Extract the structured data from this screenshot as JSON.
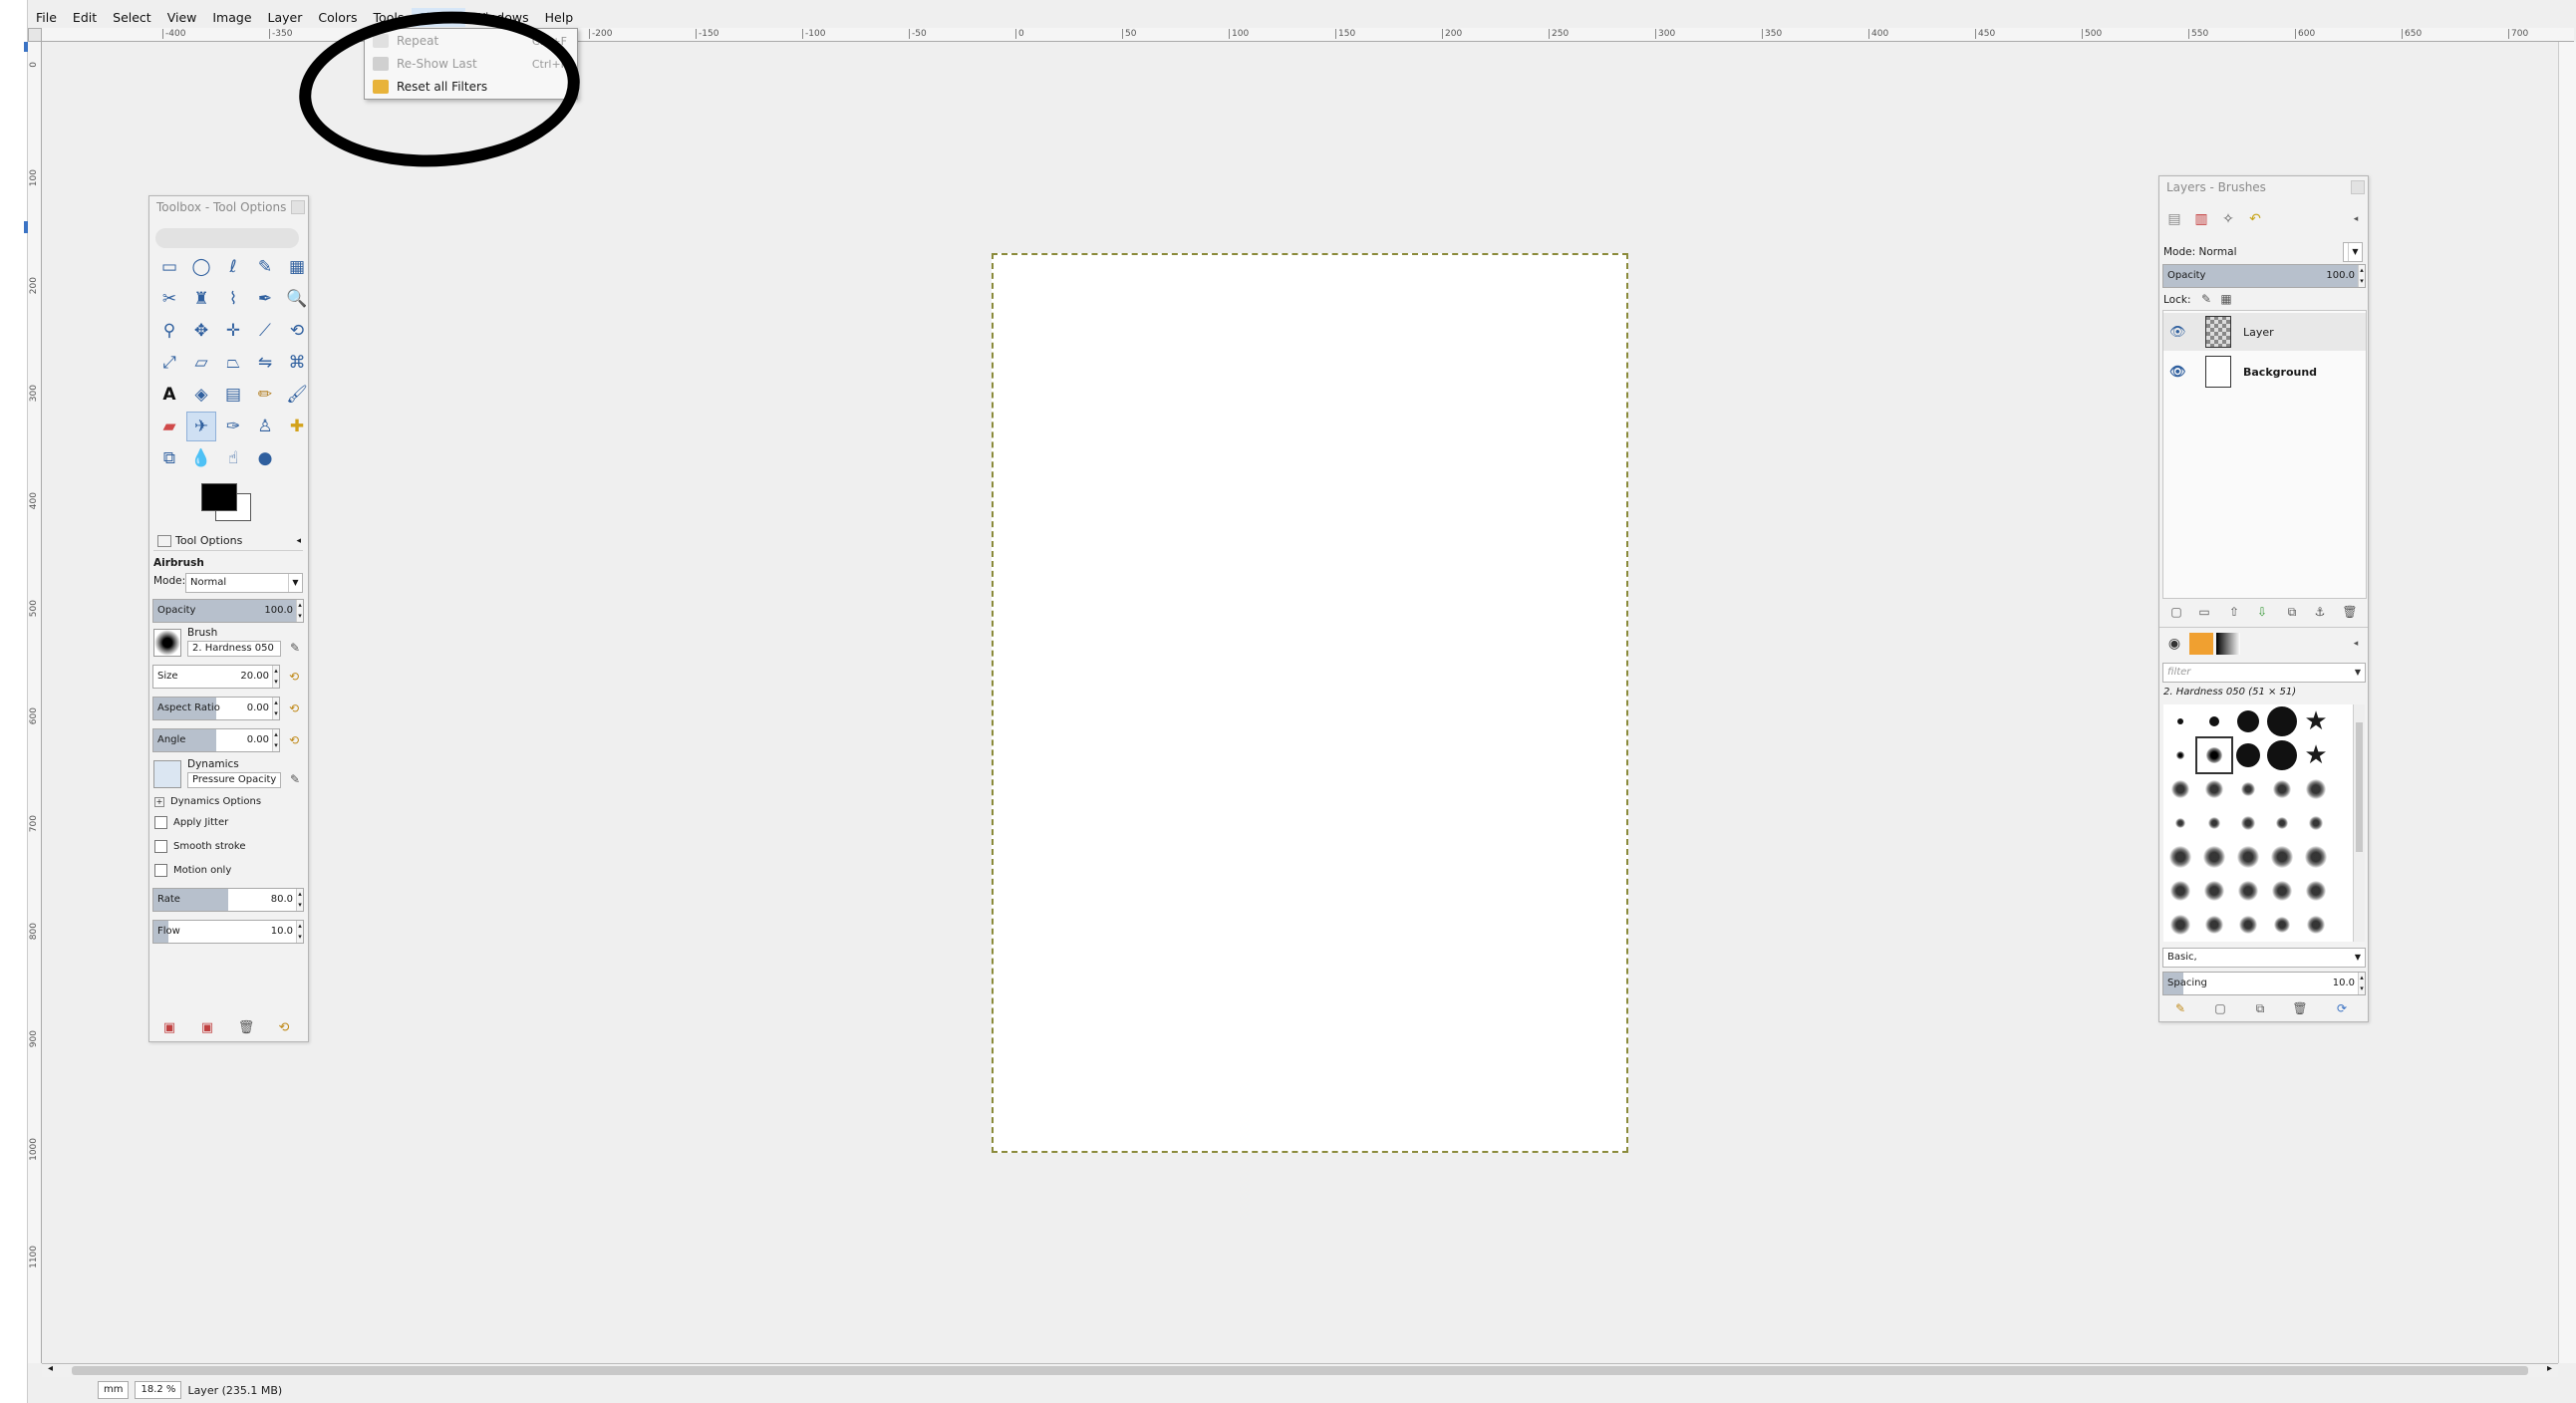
{
  "menubar": {
    "items": [
      "File",
      "Edit",
      "Select",
      "View",
      "Image",
      "Layer",
      "Colors",
      "Tools",
      "Filters",
      "Windows",
      "Help"
    ]
  },
  "filters_menu": {
    "items": [
      {
        "label": "Repeat",
        "shortcut": "Ctrl+F",
        "enabled": false
      },
      {
        "label": "Re-Show Last",
        "shortcut": "Ctrl+F",
        "enabled": false
      },
      {
        "label": "Reset all Filters",
        "shortcut": "",
        "enabled": true
      }
    ]
  },
  "ruler": {
    "top_labels": [
      "-400",
      "-350",
      "-300",
      "-250",
      "-200",
      "-150",
      "-100",
      "-50",
      "0",
      "50",
      "100",
      "150",
      "200",
      "250",
      "300",
      "350",
      "400",
      "450",
      "500",
      "550",
      "600",
      "650",
      "700"
    ],
    "left_labels": [
      "0",
      "100",
      "200",
      "300",
      "400",
      "500",
      "600",
      "700",
      "800",
      "900",
      "1000",
      "1100"
    ]
  },
  "toolbox": {
    "title": "Toolbox - Tool Options",
    "tool_options_tab": "Tool Options",
    "tool_name": "Airbrush",
    "mode_label": "Mode:",
    "mode_value": "Normal",
    "opacity": {
      "label": "Opacity",
      "value": "100.0",
      "fill": 1.0
    },
    "brush_label": "Brush",
    "brush_value": "2. Hardness 050",
    "size": {
      "label": "Size",
      "value": "20.00",
      "fill": 0.0
    },
    "aspect_ratio": {
      "label": "Aspect Ratio",
      "value": "0.00",
      "fill": 0.5
    },
    "angle": {
      "label": "Angle",
      "value": "0.00",
      "fill": 0.5
    },
    "dynamics_label": "Dynamics",
    "dynamics_value": "Pressure Opacity",
    "dynamics_options": "Dynamics Options",
    "apply_jitter": "Apply Jitter",
    "smooth_stroke": "Smooth stroke",
    "motion_only": "Motion only",
    "rate": {
      "label": "Rate",
      "value": "80.0",
      "fill": 0.5
    },
    "flow": {
      "label": "Flow",
      "value": "10.0",
      "fill": 0.1
    }
  },
  "layers_dock": {
    "title": "Layers - Brushes",
    "mode_label": "Mode:",
    "mode_value": "Normal",
    "opacity": {
      "label": "Opacity",
      "value": "100.0",
      "fill": 1.0
    },
    "lock_label": "Lock:",
    "layers": [
      {
        "name": "Layer",
        "thumb": "checker"
      },
      {
        "name": "Background",
        "thumb": "white"
      }
    ],
    "brush_filter_placeholder": "filter",
    "brush_name": "2. Hardness 050 (51 × 51)",
    "brush_category": "Basic,",
    "spacing": {
      "label": "Spacing",
      "value": "10.0",
      "fill": 0.1
    }
  },
  "statusbar": {
    "unit": "mm",
    "zoom": "18.2 %",
    "info": "Layer (235.1 MB)"
  },
  "colors": {
    "accent": "#2f5f9e",
    "selection_highlight": "#cfe0f3",
    "slider_fill": "#b7c0cc",
    "annotation": "#000000"
  }
}
